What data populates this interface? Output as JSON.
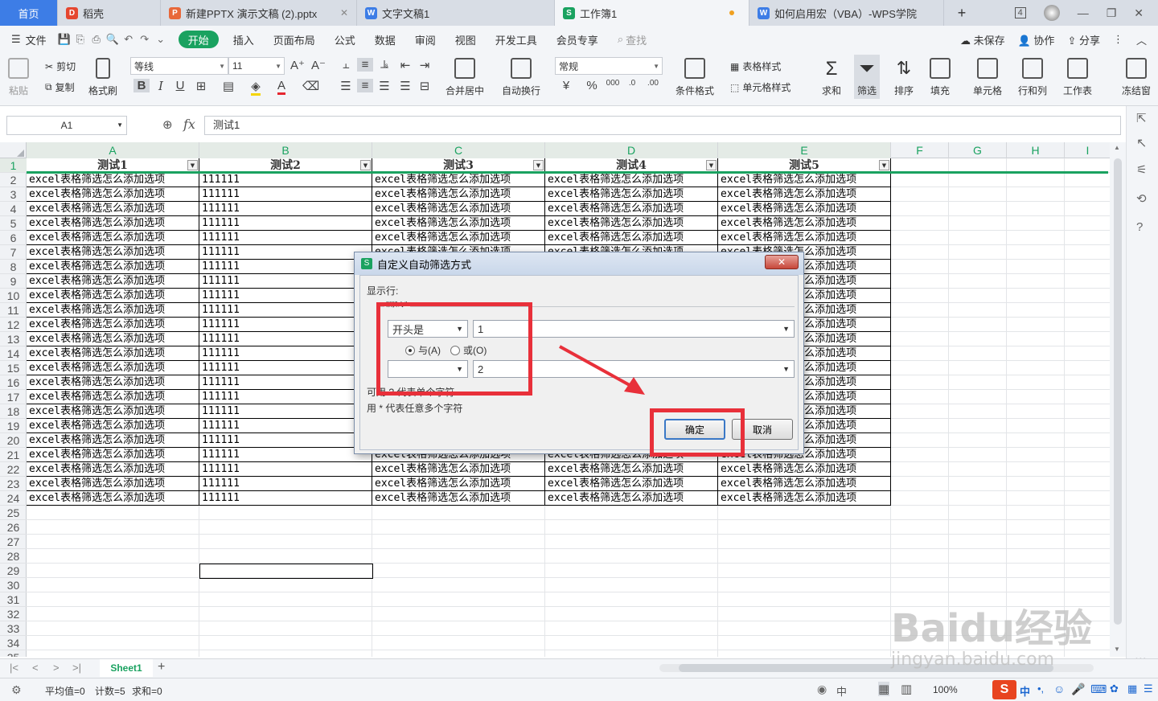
{
  "tabs": {
    "home": "首页",
    "docs": [
      {
        "label": "稻壳",
        "icon": "D",
        "color": "#e5462f"
      },
      {
        "label": "新建PPTX 演示文稿 (2).pptx",
        "icon": "P",
        "color": "#e8683a"
      },
      {
        "label": "文字文稿1",
        "icon": "W",
        "color": "#3d7de6"
      },
      {
        "label": "工作簿1",
        "icon": "S",
        "color": "#1aa260"
      },
      {
        "label": "如何启用宏（VBA）-WPS学院",
        "icon": "W",
        "color": "#3d7de6"
      }
    ],
    "new_tab": "+",
    "tab_count": "4"
  },
  "menu": {
    "file": "文件",
    "items": [
      "开始",
      "插入",
      "页面布局",
      "公式",
      "数据",
      "审阅",
      "视图",
      "开发工具",
      "会员专享"
    ],
    "search": "查找",
    "unsaved": "未保存",
    "collab": "协作",
    "share": "分享"
  },
  "ribbon": {
    "paste": "粘贴",
    "cut": "剪切",
    "copy": "复制",
    "format_painter": "格式刷",
    "font_name": "等线",
    "font_size": "11",
    "merge": "合并居中",
    "wrap": "自动换行",
    "number_format": "常规",
    "cond_format": "条件格式",
    "table_style": "表格样式",
    "cell_style": "单元格样式",
    "sum": "求和",
    "filter": "筛选",
    "sort": "排序",
    "fill": "填充",
    "cell": "单元格",
    "rowcol": "行和列",
    "worksheet": "工作表",
    "freeze": "冻结窗"
  },
  "formula": {
    "cell_ref": "A1",
    "fx": "fx",
    "value": "测试1"
  },
  "sheet": {
    "columns": [
      "A",
      "B",
      "C",
      "D",
      "E",
      "F",
      "G",
      "H",
      "I"
    ],
    "headers": [
      "测试1",
      "测试2",
      "测试3",
      "测试4",
      "测试5"
    ],
    "cell_text": "excel表格筛选怎么添加选项",
    "b_value": "111111",
    "row_count": 35,
    "data_rows": 23
  },
  "dialog": {
    "title": "自定义自动筛选方式",
    "show_rows": "显示行:",
    "field": "测试1",
    "op1": "开头是",
    "val1": "1",
    "and": "与(A)",
    "or": "或(O)",
    "op2": "",
    "val2": "2",
    "hint1": "可用 ? 代表单个字符",
    "hint2": "用 * 代表任意多个字符",
    "ok": "确定",
    "cancel": "取消"
  },
  "sheetbar": {
    "sheet_name": "Sheet1",
    "add": "+"
  },
  "status": {
    "avg": "平均值=0",
    "count": "计数=5",
    "sum": "求和=0",
    "zoom": "100%",
    "lang": "中"
  },
  "watermark": {
    "brand": "Baidu经验",
    "url": "jingyan.baidu.com"
  }
}
